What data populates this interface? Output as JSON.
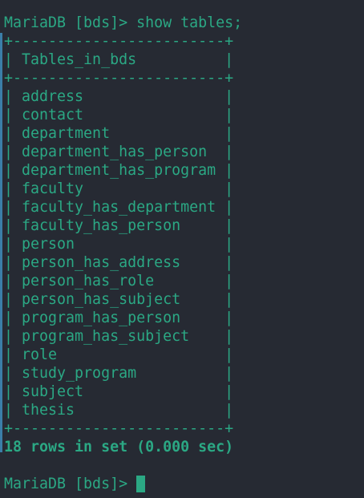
{
  "command_line": "MariaDB [bds]> show tables;",
  "table": {
    "border_top": "+------------------------+",
    "header_row": "| Tables_in_bds          |",
    "border_mid": "+------------------------+",
    "rows": [
      "| address                |",
      "| contact                |",
      "| department             |",
      "| department_has_person  |",
      "| department_has_program |",
      "| faculty                |",
      "| faculty_has_department |",
      "| faculty_has_person     |",
      "| person                 |",
      "| person_has_address     |",
      "| person_has_role        |",
      "| person_has_subject     |",
      "| program_has_person     |",
      "| program_has_subject    |",
      "| role                   |",
      "| study_program          |",
      "| subject                |",
      "| thesis                 |"
    ],
    "border_bottom": "+------------------------+"
  },
  "result_summary": "18 rows in set (0.000 sec)",
  "prompt_line": "MariaDB [bds]> ",
  "colors": {
    "background": "#262a33",
    "text": "#2ba884",
    "left_rule": "#3b7ea8"
  }
}
